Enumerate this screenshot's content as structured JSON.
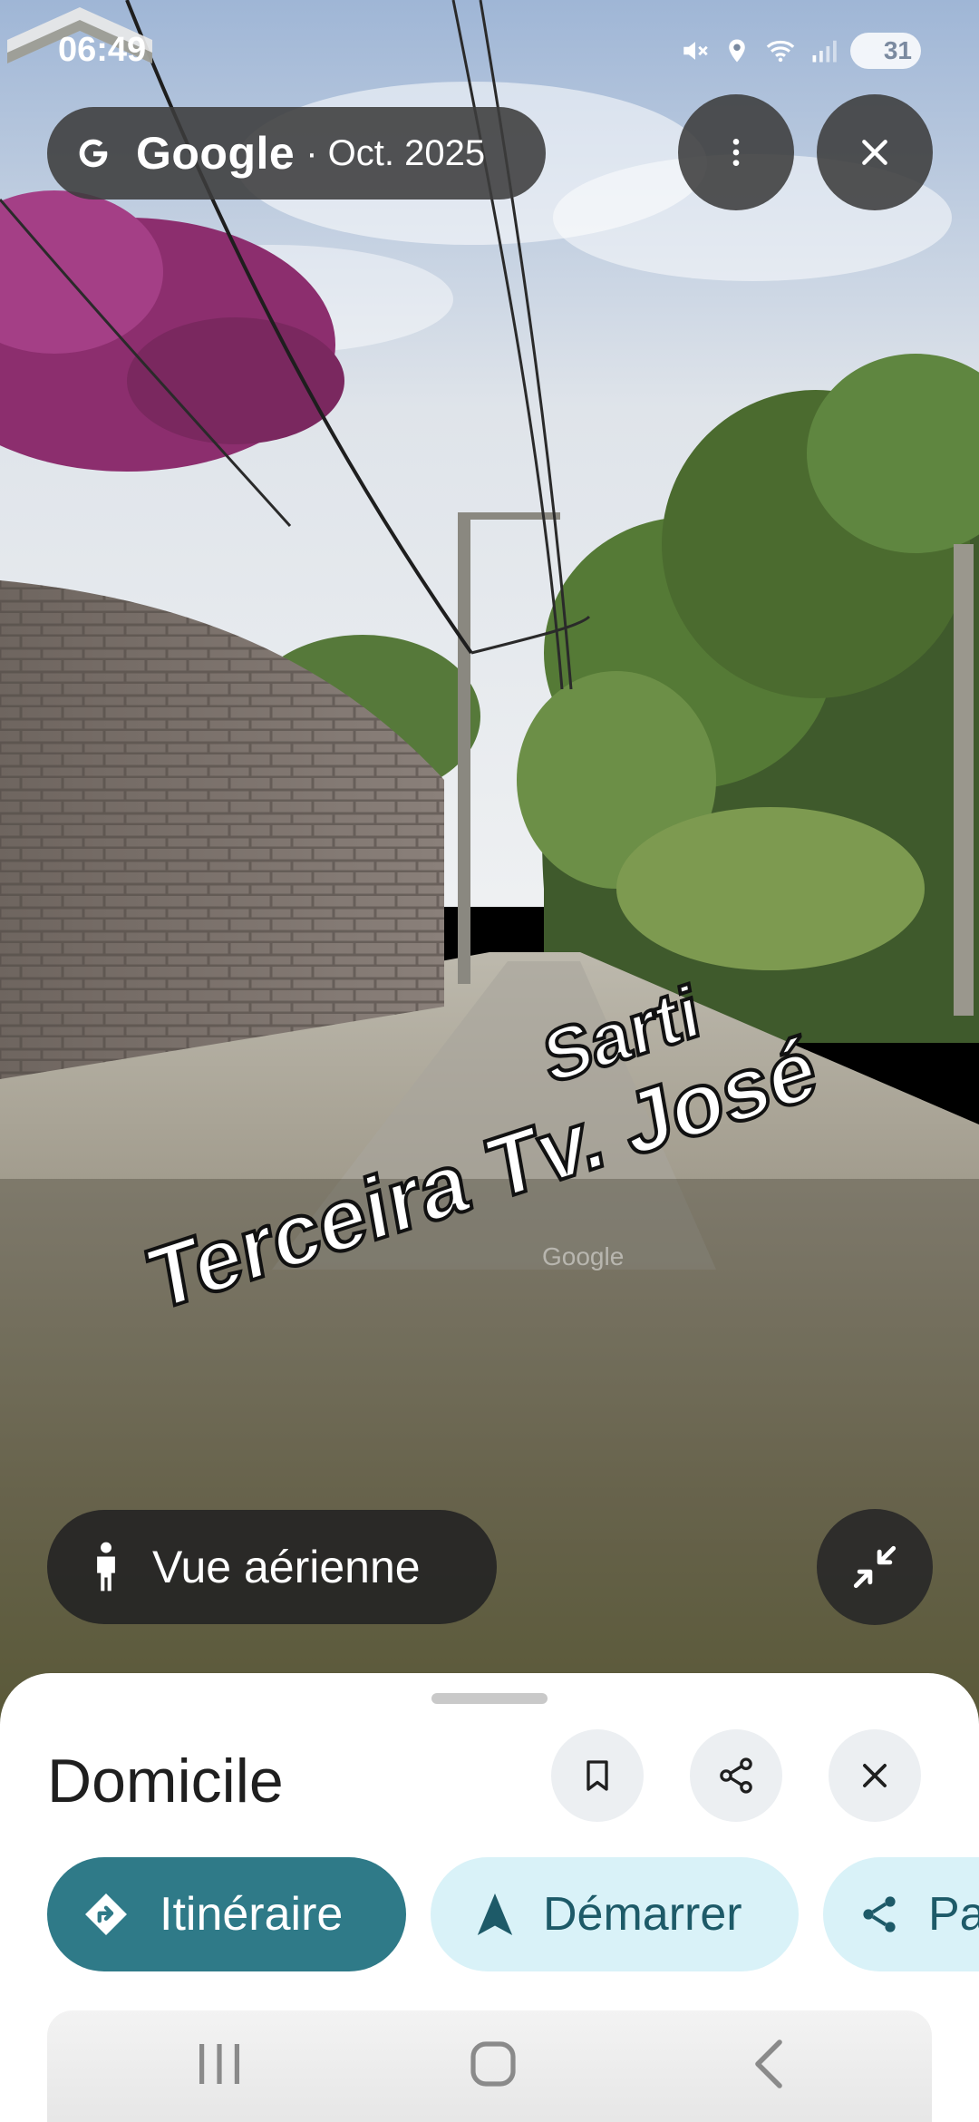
{
  "status_bar": {
    "time": "06:49",
    "battery": "31"
  },
  "street_view": {
    "brand": "Google",
    "date": "· Oct. 2025",
    "street_label_line1": "Terceira Tv. José",
    "street_label_line2": "Sarti",
    "watermark": "Google"
  },
  "controls": {
    "aerial_view_label": "Vue aérienne"
  },
  "sheet": {
    "title": "Domicile",
    "chips": [
      {
        "label": "Itinéraire",
        "icon": "directions-icon"
      },
      {
        "label": "Démarrer",
        "icon": "navigation-arrow-icon"
      },
      {
        "label": "Pa",
        "icon": "share-icon"
      }
    ]
  },
  "colors": {
    "primary_chip": "#2f7a88",
    "secondary_chip": "#d9f2f8",
    "sheet_bg": "#ffffff",
    "overlay_button": "#3c3c3c"
  }
}
